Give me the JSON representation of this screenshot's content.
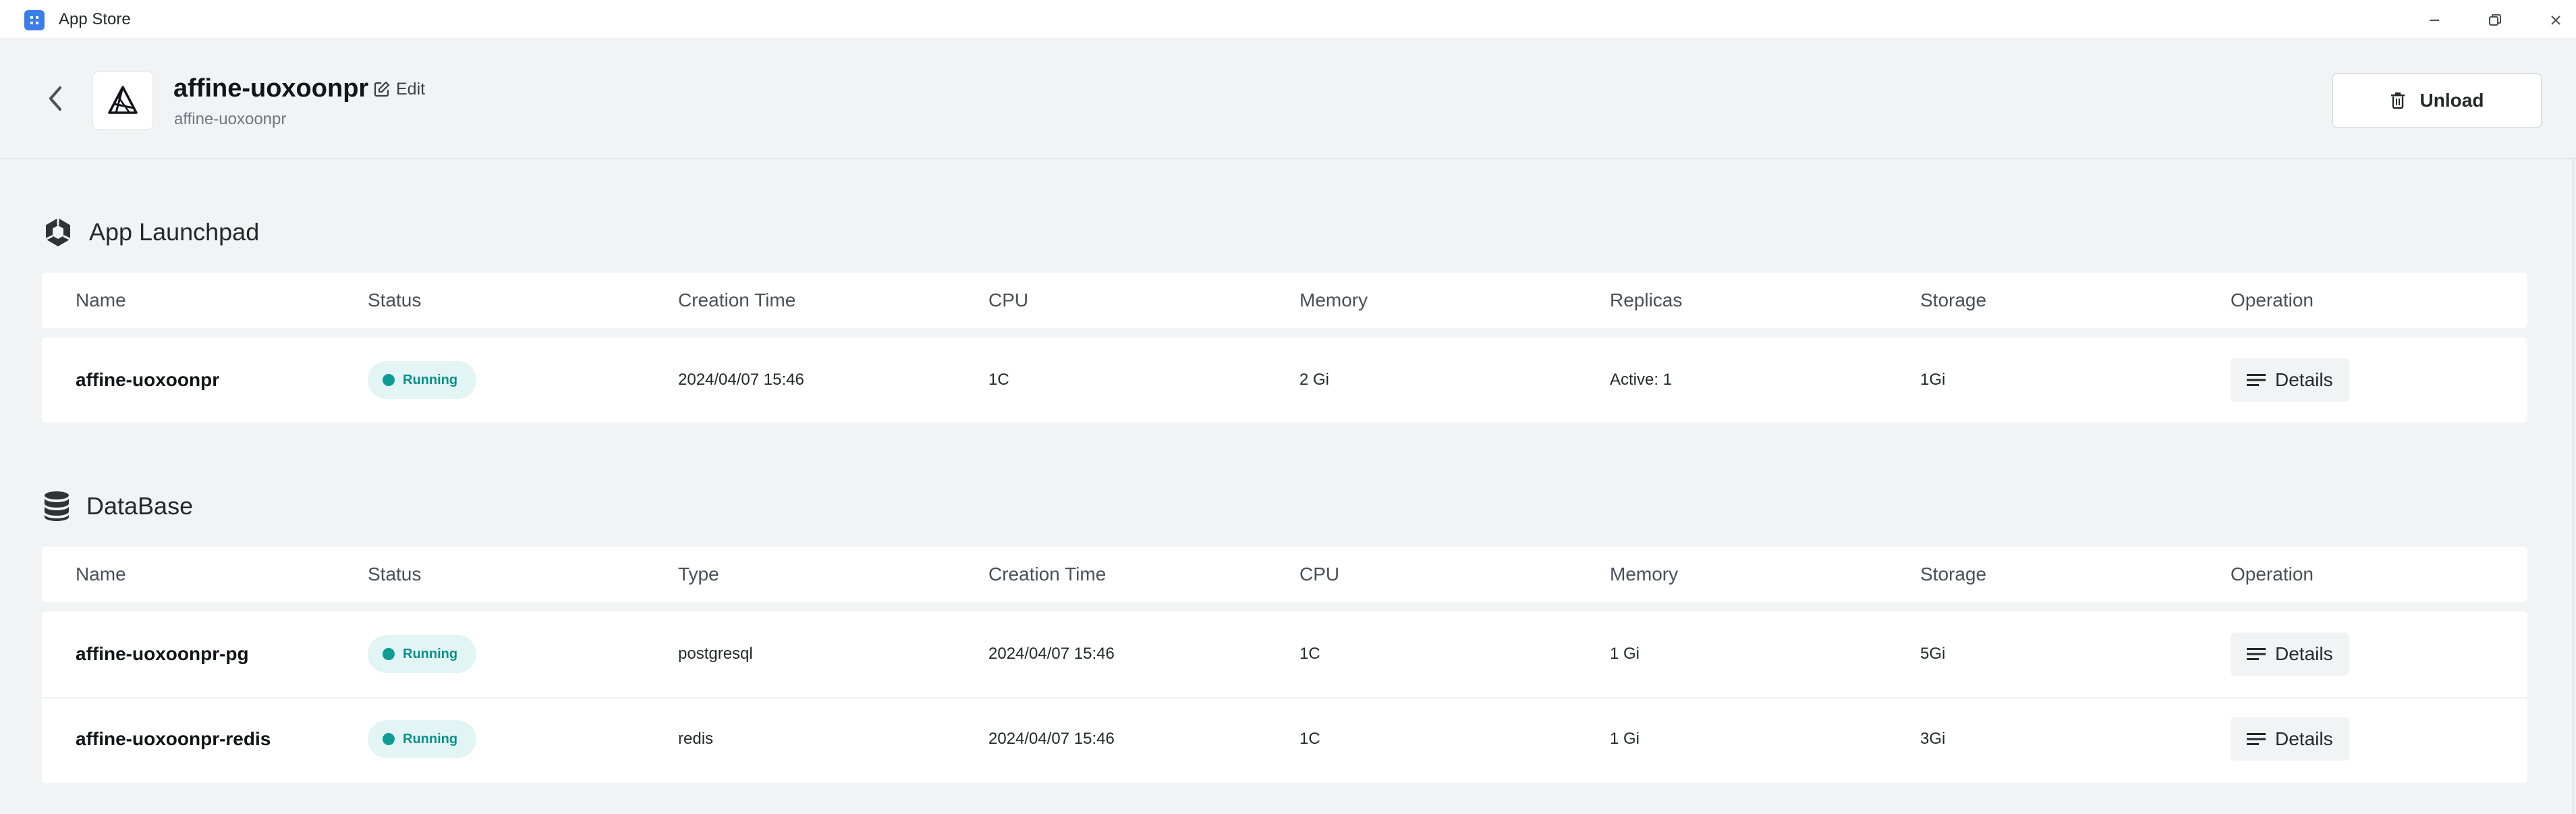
{
  "window": {
    "title": "App Store"
  },
  "header": {
    "app_name": "affine-uoxoonpr",
    "edit_label": "Edit",
    "subtitle": "affine-uoxoonpr",
    "unload_label": "Unload"
  },
  "launchpad": {
    "title": "App Launchpad",
    "columns": [
      "Name",
      "Status",
      "Creation Time",
      "CPU",
      "Memory",
      "Replicas",
      "Storage",
      "Operation"
    ],
    "rows": [
      {
        "name": "affine-uoxoonpr",
        "status": "Running",
        "creation_time": "2024/04/07 15:46",
        "cpu": "1C",
        "memory": "2 Gi",
        "replicas": "Active: 1",
        "storage": "1Gi",
        "operation": "Details"
      }
    ]
  },
  "database": {
    "title": "DataBase",
    "columns": [
      "Name",
      "Status",
      "Type",
      "Creation Time",
      "CPU",
      "Memory",
      "Storage",
      "Operation"
    ],
    "rows": [
      {
        "name": "affine-uoxoonpr-pg",
        "status": "Running",
        "type": "postgresql",
        "creation_time": "2024/04/07 15:46",
        "cpu": "1C",
        "memory": "1 Gi",
        "storage": "5Gi",
        "operation": "Details"
      },
      {
        "name": "affine-uoxoonpr-redis",
        "status": "Running",
        "type": "redis",
        "creation_time": "2024/04/07 15:46",
        "cpu": "1C",
        "memory": "1 Gi",
        "storage": "3Gi",
        "operation": "Details"
      }
    ]
  },
  "colors": {
    "accent": "#3b7de9",
    "status_running_bg": "#e2f4f3",
    "status_running_text": "#0b8f8a",
    "background": "#f2f3f5"
  },
  "icons": {
    "app": "app-store-icon",
    "back": "chevron-left-icon",
    "edit": "edit-icon",
    "unload": "trash-icon",
    "launchpad": "launchpad-icon",
    "database": "database-icon",
    "details": "list-icon"
  }
}
